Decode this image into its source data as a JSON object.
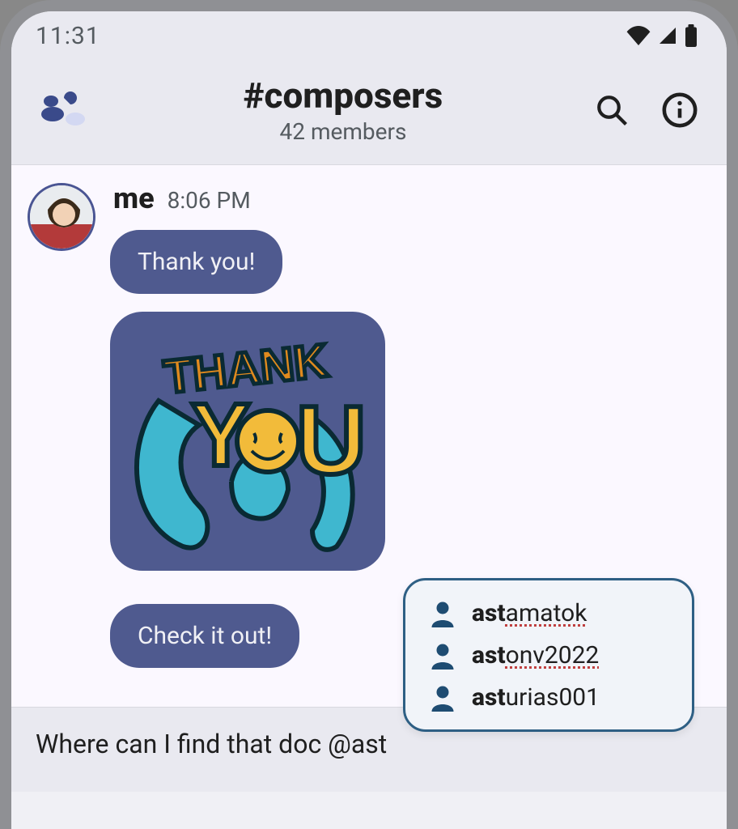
{
  "status": {
    "time": "11:31"
  },
  "header": {
    "channel": "#composers",
    "member_count": "42 members"
  },
  "message": {
    "sender": "me",
    "time": "8:06 PM",
    "bubbles": [
      "Thank you!",
      "Check it out!"
    ],
    "sticker_alt": "THANK YOU"
  },
  "compose": {
    "text": "Where can I find that doc @ast"
  },
  "mention": {
    "query": "ast",
    "suggestions": [
      {
        "match": "ast",
        "rest": "amatok",
        "underline_rest": true
      },
      {
        "match": "ast",
        "rest": "onv2022",
        "underline_rest": true
      },
      {
        "match": "ast",
        "rest": "urias001",
        "underline_rest": false
      }
    ]
  },
  "icons": {
    "app": "app-icon",
    "search": "search-icon",
    "info": "info-icon",
    "wifi": "wifi-icon",
    "cell": "cell-icon",
    "battery": "battery-icon",
    "person": "person-icon"
  }
}
